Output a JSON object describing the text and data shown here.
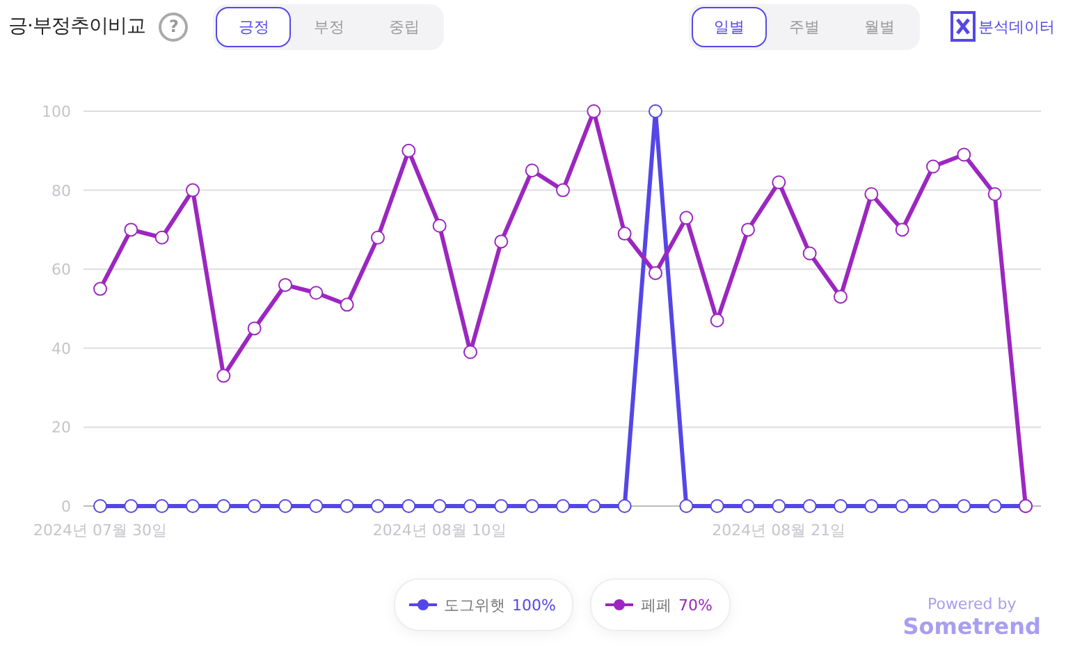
{
  "header": {
    "title": "긍·부정추이비교",
    "help": "?"
  },
  "sentiment_tabs": [
    {
      "label": "긍정",
      "selected": true
    },
    {
      "label": "부정",
      "selected": false
    },
    {
      "label": "중립",
      "selected": false
    }
  ],
  "period_tabs": [
    {
      "label": "일별",
      "selected": true
    },
    {
      "label": "주별",
      "selected": false
    },
    {
      "label": "월별",
      "selected": false
    }
  ],
  "export_button": {
    "label": "분석데이터"
  },
  "chart_data": {
    "type": "line",
    "grid": true,
    "categories": [
      "2024년 07월 30일",
      null,
      null,
      null,
      null,
      null,
      null,
      null,
      null,
      null,
      null,
      "2024년 08월 10일",
      null,
      null,
      null,
      null,
      null,
      null,
      null,
      null,
      null,
      null,
      "2024년 08월 21일",
      null,
      null,
      null,
      null,
      null,
      null,
      null,
      null
    ],
    "ylim": [
      0,
      100
    ],
    "yticks": [
      0,
      20,
      40,
      60,
      80,
      100
    ],
    "series": [
      {
        "name": "도그위햇",
        "color": "#5546e6",
        "marker": "circle",
        "values": [
          0,
          0,
          0,
          0,
          0,
          0,
          0,
          0,
          0,
          0,
          0,
          0,
          0,
          0,
          0,
          0,
          0,
          0,
          100,
          0,
          0,
          0,
          0,
          0,
          0,
          0,
          0,
          0,
          0,
          0,
          0
        ]
      },
      {
        "name": "페페",
        "color": "#9b27c0",
        "marker": "circle",
        "values": [
          55,
          70,
          68,
          80,
          33,
          45,
          56,
          54,
          51,
          68,
          90,
          71,
          39,
          67,
          85,
          80,
          100,
          69,
          59,
          73,
          47,
          70,
          82,
          64,
          53,
          79,
          70,
          86,
          89,
          79,
          0
        ]
      }
    ]
  },
  "legend": [
    {
      "share": "100%"
    },
    {
      "share": "70%"
    }
  ],
  "branding": {
    "caption": "Powered by",
    "name": "Sometrend"
  }
}
